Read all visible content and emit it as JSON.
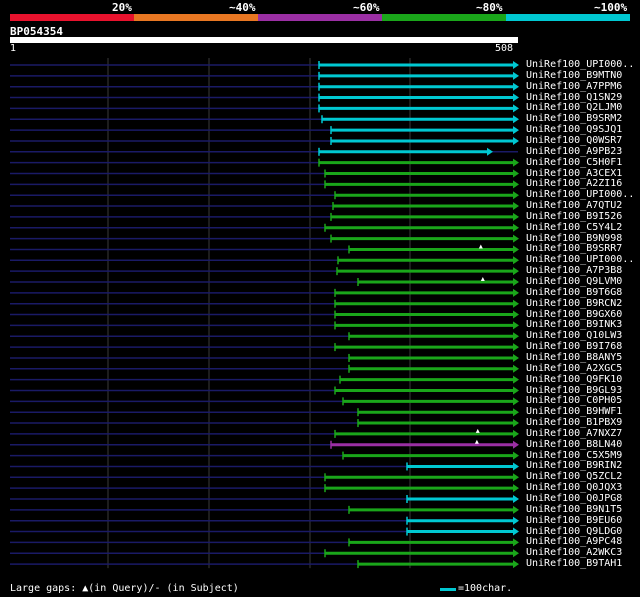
{
  "legend": {
    "labels": [
      "20%",
      "~40%",
      "~60%",
      "~80%",
      "~100%"
    ],
    "colors": [
      "#e8122d",
      "#e87722",
      "#9b2fa4",
      "#1aa61a",
      "#00c8d2"
    ]
  },
  "query": {
    "id": "BP054354",
    "start": "1",
    "end": "508",
    "length": 508
  },
  "colors": {
    "background": "#000000",
    "query_bar": "#ffffff",
    "backbone": "#1a1a66",
    "grid": "#3a3a3a"
  },
  "hits": [
    {
      "label": "UniRef100_UPI000..",
      "start": 309,
      "end": 508,
      "color": "#00c8d2",
      "marker": false
    },
    {
      "label": "UniRef100_B9MTN0",
      "start": 309,
      "end": 508,
      "color": "#00c8d2",
      "marker": false
    },
    {
      "label": "UniRef100_A7PPM6",
      "start": 309,
      "end": 508,
      "color": "#00c8d2",
      "marker": false
    },
    {
      "label": "UniRef100_Q1SN29",
      "start": 309,
      "end": 508,
      "color": "#00c8d2",
      "marker": false
    },
    {
      "label": "UniRef100_Q2LJM0",
      "start": 309,
      "end": 508,
      "color": "#00c8d2",
      "marker": false
    },
    {
      "label": "UniRef100_B9SRM2",
      "start": 312,
      "end": 508,
      "color": "#00c8d2",
      "marker": false
    },
    {
      "label": "UniRef100_Q9SJQ1",
      "start": 321,
      "end": 508,
      "color": "#00c8d2",
      "marker": false
    },
    {
      "label": "UniRef100_Q0WSR7",
      "start": 321,
      "end": 508,
      "color": "#00c8d2",
      "marker": false
    },
    {
      "label": "UniRef100_A9PB23",
      "start": 309,
      "end": 482,
      "color": "#00c8d2",
      "marker": false
    },
    {
      "label": "UniRef100_C5H0F1",
      "start": 309,
      "end": 508,
      "color": "#1aa61a",
      "marker": false
    },
    {
      "label": "UniRef100_A3CEX1",
      "start": 315,
      "end": 508,
      "color": "#1aa61a",
      "marker": false
    },
    {
      "label": "UniRef100_A2ZI16",
      "start": 315,
      "end": 508,
      "color": "#1aa61a",
      "marker": false
    },
    {
      "label": "UniRef100_UPI000..",
      "start": 325,
      "end": 508,
      "color": "#1aa61a",
      "marker": false
    },
    {
      "label": "UniRef100_A7QTU2",
      "start": 323,
      "end": 508,
      "color": "#1aa61a",
      "marker": false
    },
    {
      "label": "UniRef100_B9I526",
      "start": 321,
      "end": 508,
      "color": "#1aa61a",
      "marker": false
    },
    {
      "label": "UniRef100_C5Y4L2",
      "start": 315,
      "end": 508,
      "color": "#1aa61a",
      "marker": false
    },
    {
      "label": "UniRef100_B9N998",
      "start": 321,
      "end": 508,
      "color": "#1aa61a",
      "marker": false
    },
    {
      "label": "UniRef100_B9SRR7",
      "start": 339,
      "end": 508,
      "color": "#1aa61a",
      "marker": true
    },
    {
      "label": "UniRef100_UPI000..",
      "start": 328,
      "end": 508,
      "color": "#1aa61a",
      "marker": false
    },
    {
      "label": "UniRef100_A7P3B8",
      "start": 327,
      "end": 508,
      "color": "#1aa61a",
      "marker": false
    },
    {
      "label": "UniRef100_Q9LVM0",
      "start": 348,
      "end": 508,
      "color": "#1aa61a",
      "marker": true
    },
    {
      "label": "UniRef100_B9T6G8",
      "start": 325,
      "end": 508,
      "color": "#1aa61a",
      "marker": false
    },
    {
      "label": "UniRef100_B9RCN2",
      "start": 325,
      "end": 508,
      "color": "#1aa61a",
      "marker": false
    },
    {
      "label": "UniRef100_B9GX60",
      "start": 325,
      "end": 508,
      "color": "#1aa61a",
      "marker": false
    },
    {
      "label": "UniRef100_B9INK3",
      "start": 325,
      "end": 508,
      "color": "#1aa61a",
      "marker": false
    },
    {
      "label": "UniRef100_Q10LW3",
      "start": 339,
      "end": 508,
      "color": "#1aa61a",
      "marker": false
    },
    {
      "label": "UniRef100_B9I768",
      "start": 325,
      "end": 508,
      "color": "#1aa61a",
      "marker": false
    },
    {
      "label": "UniRef100_B8ANY5",
      "start": 339,
      "end": 508,
      "color": "#1aa61a",
      "marker": false
    },
    {
      "label": "UniRef100_A2XGC5",
      "start": 339,
      "end": 508,
      "color": "#1aa61a",
      "marker": false
    },
    {
      "label": "UniRef100_Q9FK10",
      "start": 330,
      "end": 508,
      "color": "#1aa61a",
      "marker": false
    },
    {
      "label": "UniRef100_B9GL93",
      "start": 325,
      "end": 508,
      "color": "#1aa61a",
      "marker": false
    },
    {
      "label": "UniRef100_C0PH05",
      "start": 333,
      "end": 508,
      "color": "#1aa61a",
      "marker": false
    },
    {
      "label": "UniRef100_B9HWF1",
      "start": 348,
      "end": 508,
      "color": "#1aa61a",
      "marker": false
    },
    {
      "label": "UniRef100_B1PBX9",
      "start": 348,
      "end": 508,
      "color": "#1aa61a",
      "marker": false
    },
    {
      "label": "UniRef100_A7NXZ7",
      "start": 325,
      "end": 508,
      "color": "#1aa61a",
      "marker": true
    },
    {
      "label": "UniRef100_B8LN40",
      "start": 321,
      "end": 508,
      "color": "#9b2fa4",
      "marker": true
    },
    {
      "label": "UniRef100_C5X5M9",
      "start": 333,
      "end": 508,
      "color": "#1aa61a",
      "marker": false
    },
    {
      "label": "UniRef100_B9RIN2",
      "start": 397,
      "end": 508,
      "color": "#00c8d2",
      "marker": false
    },
    {
      "label": "UniRef100_Q5ZCL2",
      "start": 315,
      "end": 508,
      "color": "#1aa61a",
      "marker": false
    },
    {
      "label": "UniRef100_Q0JQX3",
      "start": 315,
      "end": 508,
      "color": "#1aa61a",
      "marker": false
    },
    {
      "label": "UniRef100_Q0JPG8",
      "start": 397,
      "end": 508,
      "color": "#00c8d2",
      "marker": false
    },
    {
      "label": "UniRef100_B9N1T5",
      "start": 339,
      "end": 508,
      "color": "#1aa61a",
      "marker": false
    },
    {
      "label": "UniRef100_B9EU60",
      "start": 397,
      "end": 508,
      "color": "#00c8d2",
      "marker": false
    },
    {
      "label": "UniRef100_Q9LDG0",
      "start": 397,
      "end": 508,
      "color": "#00c8d2",
      "marker": false
    },
    {
      "label": "UniRef100_A9PC48",
      "start": 339,
      "end": 508,
      "color": "#1aa61a",
      "marker": false
    },
    {
      "label": "UniRef100_A2WKC3",
      "start": 315,
      "end": 508,
      "color": "#1aa61a",
      "marker": false
    },
    {
      "label": "UniRef100_B9TAH1",
      "start": 348,
      "end": 508,
      "color": "#1aa61a",
      "marker": false
    }
  ],
  "footer": {
    "gaps_text": "Large gaps: ▲(in Query)/- (in Subject)",
    "scale_text": "=100char."
  }
}
